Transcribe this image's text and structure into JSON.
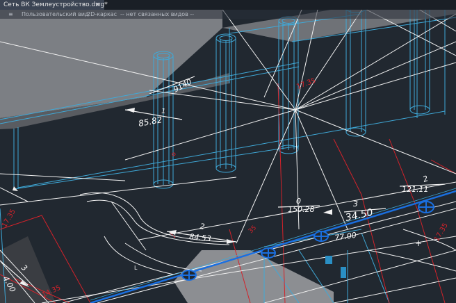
{
  "document_tab": {
    "title": "Сеть ВК Землеустройство.dwg*",
    "close_glyph": "×"
  },
  "viewport_controls": {
    "menu_glyph": "≡",
    "view_label": "Пользовательский вид",
    "visual_style_label": "2D-каркас",
    "linked_views_label": "-- нет связанных видов --"
  },
  "drawing_labels": {
    "dim_9140": "9140",
    "dim_1_top": "1",
    "dim_8582": "85.82",
    "dim_0": "0",
    "dim_15028": "150.28",
    "dim_2_right": "2",
    "dim_12111": "121.11",
    "dim_3": "3",
    "dim_3450": "34.50",
    "dim_7700": "77.00",
    "dim_2_left": "2",
    "dim_8453": "84.53",
    "dim_3_left": "3",
    "dim_400": "4.00",
    "red_1735_left": "17.35",
    "red_1735_top": "17.35",
    "red_1735_right": "17.35",
    "red_1435": "14.35",
    "red_35": "35"
  },
  "colors": {
    "background": "#212830",
    "gray_slab": "#7c7f84",
    "cyan_structure": "#3fa9d8",
    "pipe_blue": "#1a6fe0",
    "red_annotation": "#d4222a",
    "white_linework": "#ffffff"
  }
}
